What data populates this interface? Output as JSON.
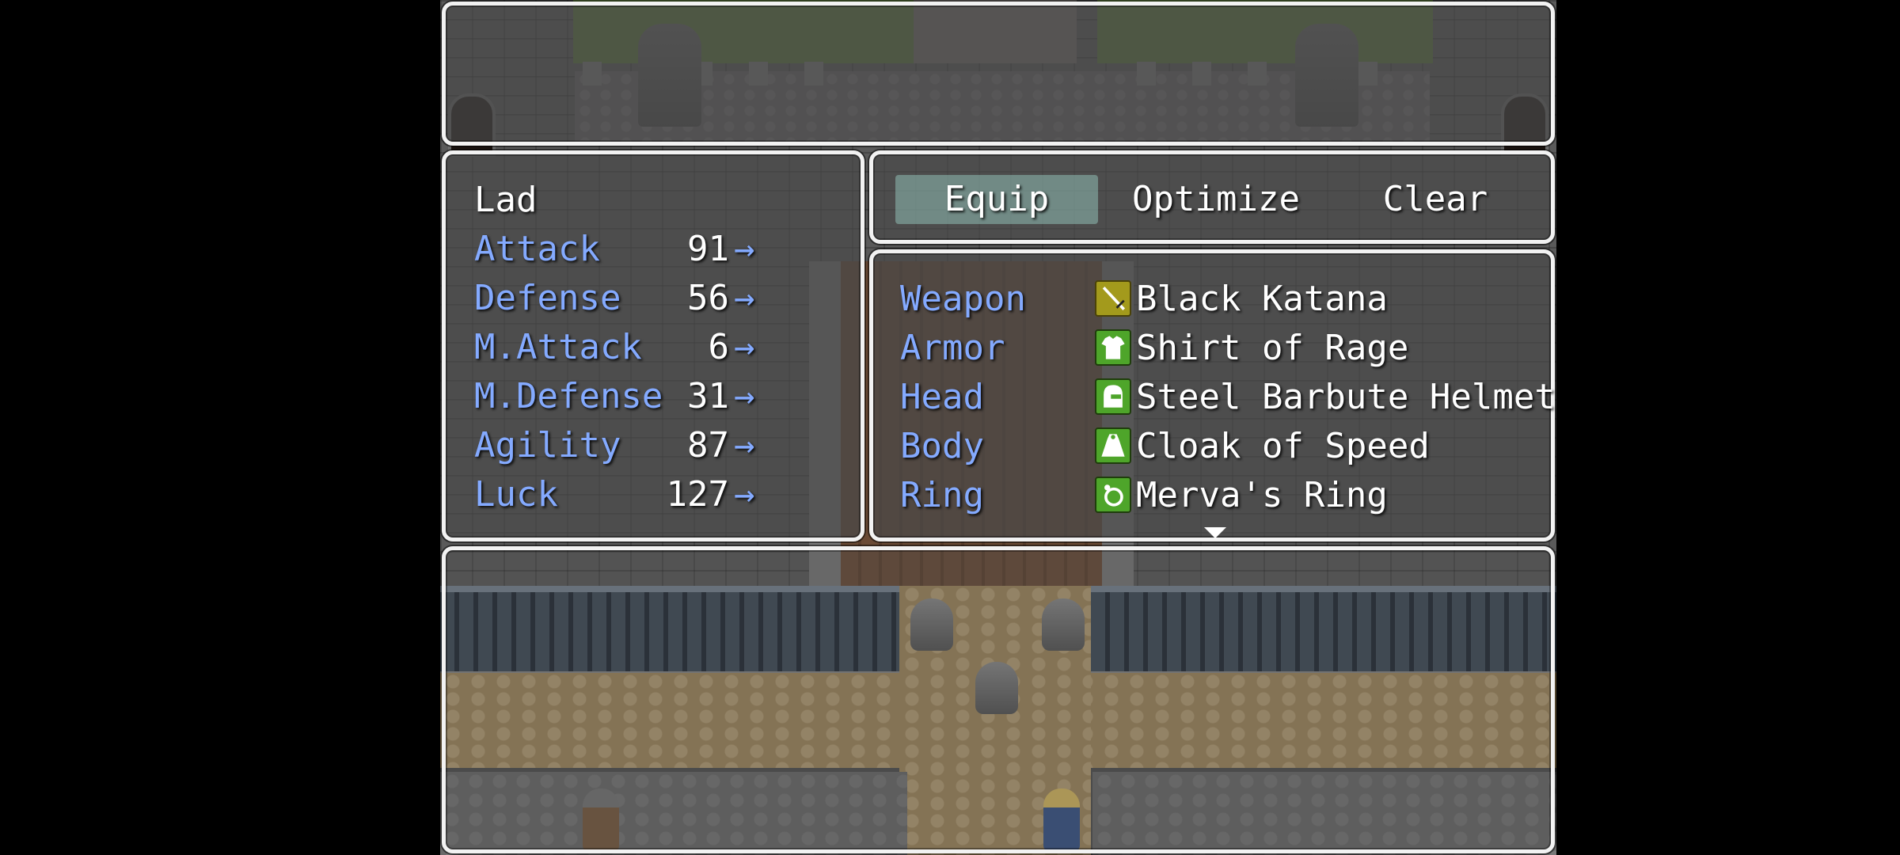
{
  "status": {
    "actor_name": "Lad",
    "stats": [
      {
        "label": "Attack",
        "value": "91",
        "arrow": "→"
      },
      {
        "label": "Defense",
        "value": "56",
        "arrow": "→"
      },
      {
        "label": "M.Attack",
        "value": "6",
        "arrow": "→"
      },
      {
        "label": "M.Defense",
        "value": "31",
        "arrow": "→"
      },
      {
        "label": "Agility",
        "value": "87",
        "arrow": "→"
      },
      {
        "label": "Luck",
        "value": "127",
        "arrow": "→"
      }
    ]
  },
  "commands": {
    "equip": "Equip",
    "optimize": "Optimize",
    "clear": "Clear",
    "selected": "equip"
  },
  "slots": [
    {
      "slot": "Weapon",
      "item": "Black Katana",
      "icon": "sword-icon"
    },
    {
      "slot": "Armor",
      "item": "Shirt of Rage",
      "icon": "shirt-icon"
    },
    {
      "slot": "Head",
      "item": "Steel Barbute Helmet",
      "icon": "helmet-icon"
    },
    {
      "slot": "Body",
      "item": "Cloak of Speed",
      "icon": "cloak-icon"
    },
    {
      "slot": "Ring",
      "item": "Merva's Ring",
      "icon": "ring-icon"
    }
  ],
  "colors": {
    "system_text": "#84aaff",
    "normal_text": "#ffffff",
    "window_border": "#f2f2f2",
    "command_highlight": "#96c8be"
  }
}
